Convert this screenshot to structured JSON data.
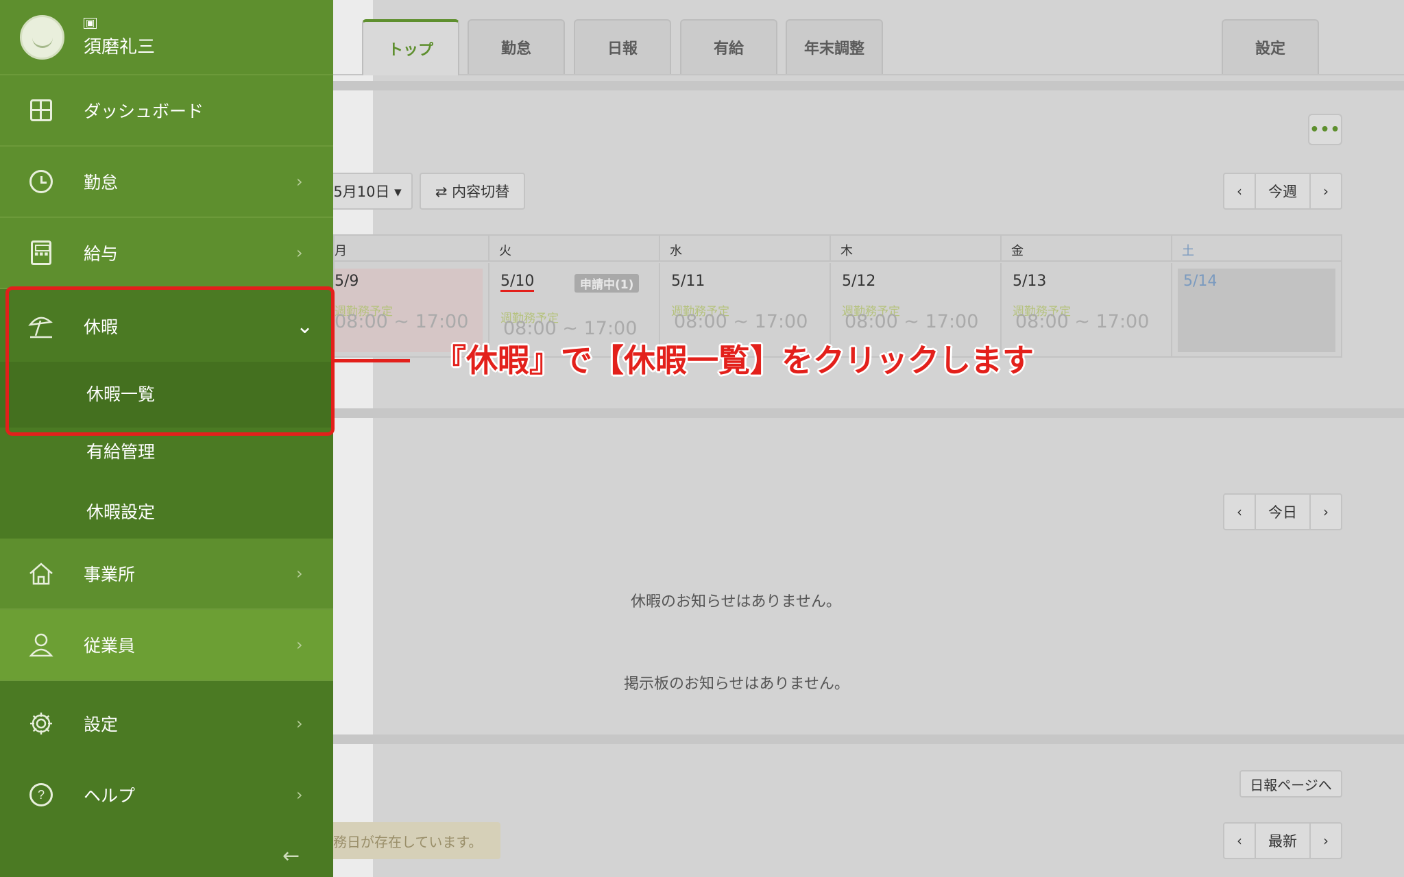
{
  "user": {
    "badge": "▣",
    "name": "須磨礼三"
  },
  "sidebar": {
    "items": [
      {
        "label": "ダッシュボード"
      },
      {
        "label": "勤怠",
        "chevron": "›"
      },
      {
        "label": "給与",
        "chevron": "›"
      },
      {
        "label": "休暇",
        "chevron": "⌄"
      },
      {
        "label": "事業所",
        "chevron": "›"
      },
      {
        "label": "従業員",
        "chevron": "›"
      },
      {
        "label": "設定",
        "chevron": "›"
      },
      {
        "label": "ヘルプ",
        "chevron": "›"
      }
    ],
    "sub_items": [
      {
        "label": "休暇一覧"
      },
      {
        "label": "有給管理"
      },
      {
        "label": "休暇設定"
      }
    ],
    "collapse_arrow": "←",
    "help_icon_glyph": "?",
    "accent_color": "#5e8f2e"
  },
  "tabs": [
    {
      "label": "トップ"
    },
    {
      "label": "勤怠"
    },
    {
      "label": "日報"
    },
    {
      "label": "有給"
    },
    {
      "label": "年末調整"
    },
    {
      "label": "設定"
    }
  ],
  "toolbar": {
    "more_label": "•••",
    "date_select": "5月10日 ▾",
    "switch_label": "⇄ 内容切替",
    "week_nav": {
      "prev": "‹",
      "current": "今週",
      "next": "›"
    }
  },
  "calendar": {
    "days": [
      {
        "weekday": "月",
        "date": "5/9",
        "plan": "週勤務予定",
        "time": "08:00 ~ 17:00"
      },
      {
        "weekday": "火",
        "date": "5/10",
        "plan": "週勤務予定",
        "time": "08:00 ~ 17:00",
        "badge": "申請中(1)"
      },
      {
        "weekday": "水",
        "date": "5/11",
        "plan": "週勤務予定",
        "time": "08:00 ~ 17:00"
      },
      {
        "weekday": "木",
        "date": "5/12",
        "plan": "週勤務予定",
        "time": "08:00 ~ 17:00"
      },
      {
        "weekday": "金",
        "date": "5/13",
        "plan": "週勤務予定",
        "time": "08:00 ~ 17:00"
      },
      {
        "weekday": "土",
        "date": "5/14"
      }
    ]
  },
  "notices": {
    "day_nav": {
      "prev": "‹",
      "current": "今日",
      "next": "›"
    },
    "leave_notice": "休暇のお知らせはありません。",
    "board_notice": "掲示板のお知らせはありません。"
  },
  "daily": {
    "page_link": "日報ページへ",
    "latest_nav": {
      "prev": "‹",
      "current": "最新",
      "next": "›"
    },
    "warning": "務日が存在しています。"
  },
  "annotation": {
    "text": "『休暇』で【休暇一覧】をクリックします",
    "color": "#e3201b"
  }
}
